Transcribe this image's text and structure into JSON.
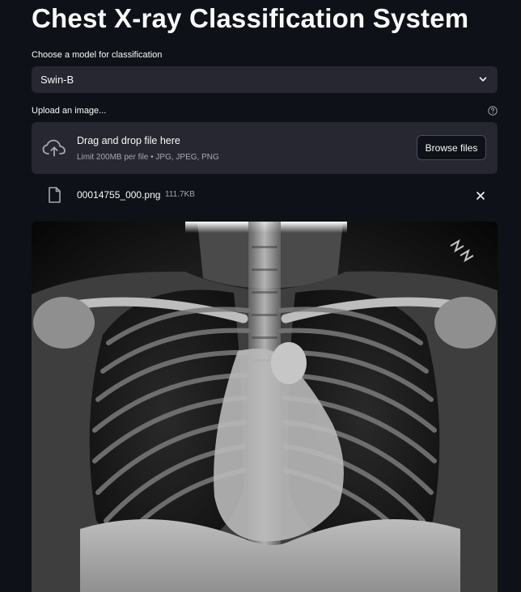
{
  "header": {
    "title": "Chest X-ray Classification System"
  },
  "model_select": {
    "label": "Choose a model for classification",
    "selected": "Swin-B"
  },
  "uploader": {
    "label": "Upload an image...",
    "dropzone_text": "Drag and drop file here",
    "limit_text": "Limit 200MB per file • JPG, JPEG, PNG",
    "browse_label": "Browse files"
  },
  "uploaded_file": {
    "name": "00014755_000.png",
    "size": "111.7KB"
  },
  "icons": {
    "select": "chevron-down-icon",
    "help": "help-circle-icon",
    "upload": "cloud-upload-icon",
    "file": "file-icon",
    "remove": "close-icon"
  },
  "colors": {
    "background": "#0e1117",
    "widget": "#262730",
    "text": "#fafafa",
    "muted": "#a3a8b4"
  }
}
